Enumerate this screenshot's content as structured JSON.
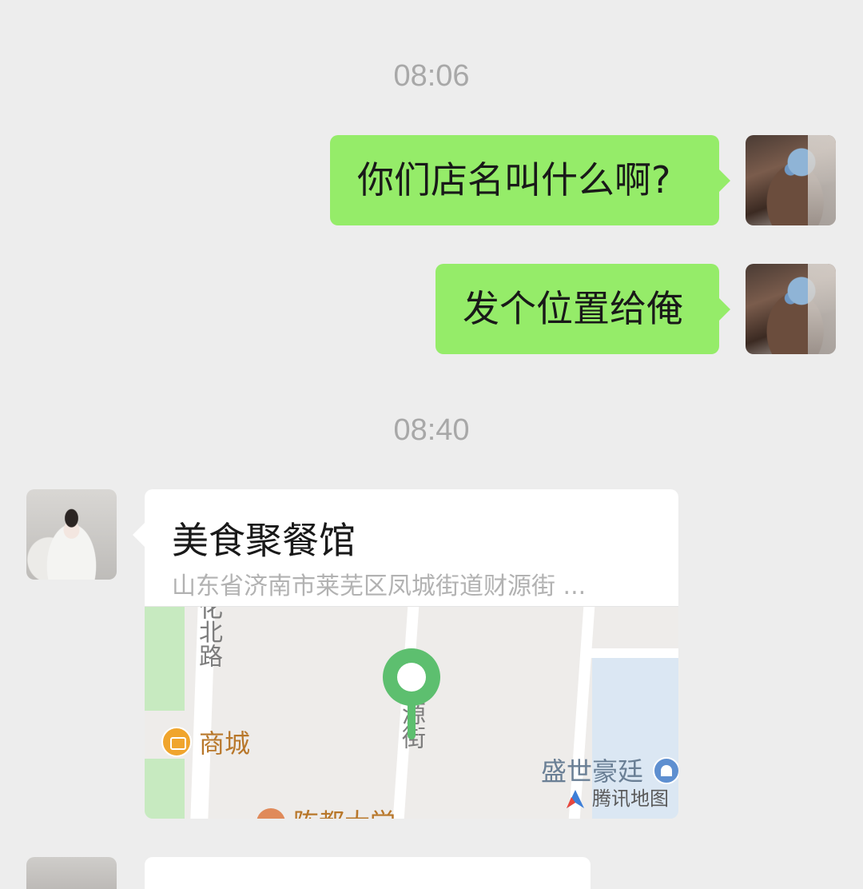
{
  "chat": {
    "timestamps": [
      "08:06",
      "08:40"
    ],
    "messages": [
      {
        "sender": "self",
        "text": "你们店名叫什么啊?"
      },
      {
        "sender": "self",
        "text": "发个位置给俺"
      }
    ],
    "location_message": {
      "sender": "other",
      "title": "美食聚餐馆",
      "address": "山东省济南市莱芜区凤城街道财源街 ...",
      "map": {
        "labels": {
          "road_left": "北路",
          "road_left_partial": "化",
          "poi_mall": "商城",
          "road_center": "源街",
          "poi_building": "盛世豪廷",
          "poi_bottom": "陈都大学",
          "provider": "腾讯地图"
        },
        "pin_color": "#5dbf6f"
      }
    }
  },
  "colors": {
    "background": "#ededed",
    "self_bubble": "#95ec69",
    "other_bubble": "#ffffff",
    "timestamp": "#a8a8a8"
  }
}
